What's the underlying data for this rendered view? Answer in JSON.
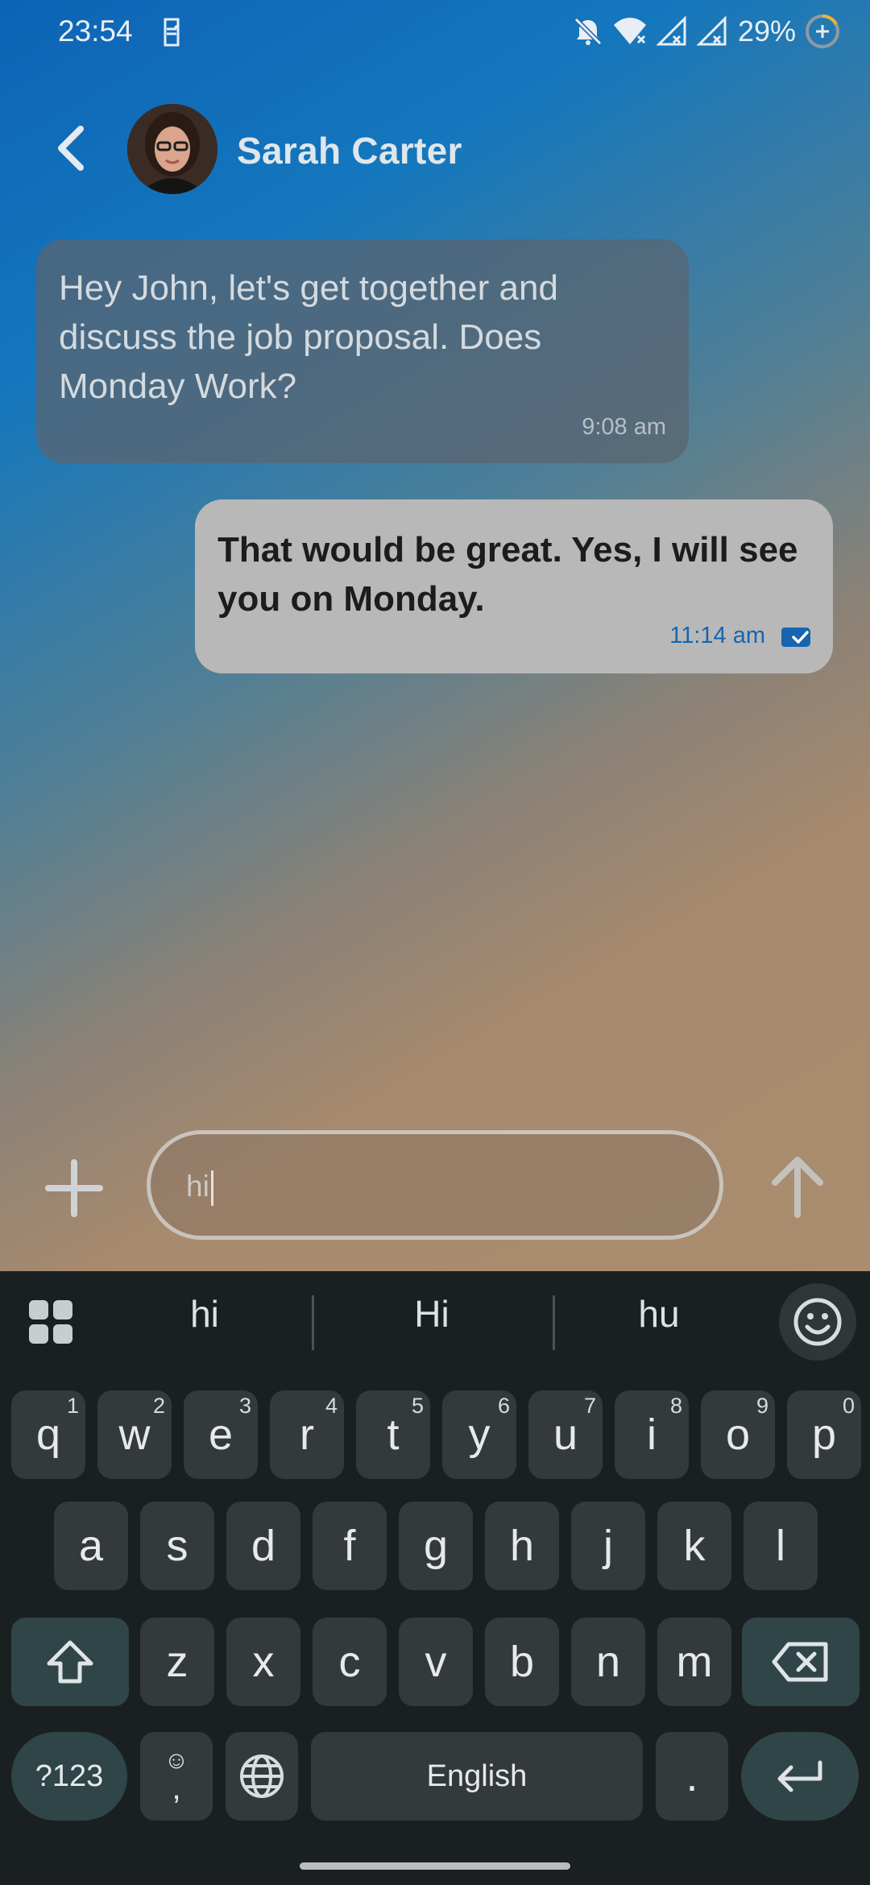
{
  "status_bar": {
    "time": "23:54",
    "battery": "29%"
  },
  "header": {
    "contact_name": "Sarah Carter"
  },
  "messages": [
    {
      "direction": "incoming",
      "text": "Hey John, let's get together and discuss the job proposal. Does Monday Work?",
      "time": "9:08 am"
    },
    {
      "direction": "outgoing",
      "text": "That would be great. Yes, I will see you on Monday.",
      "time": "11:14 am"
    }
  ],
  "composer": {
    "value": "hi"
  },
  "keyboard": {
    "suggestions": [
      "hi",
      "Hi",
      "hu"
    ],
    "row1": [
      {
        "k": "q",
        "h": "1"
      },
      {
        "k": "w",
        "h": "2"
      },
      {
        "k": "e",
        "h": "3"
      },
      {
        "k": "r",
        "h": "4"
      },
      {
        "k": "t",
        "h": "5"
      },
      {
        "k": "y",
        "h": "6"
      },
      {
        "k": "u",
        "h": "7"
      },
      {
        "k": "i",
        "h": "8"
      },
      {
        "k": "o",
        "h": "9"
      },
      {
        "k": "p",
        "h": "0"
      }
    ],
    "row2": [
      "a",
      "s",
      "d",
      "f",
      "g",
      "h",
      "j",
      "k",
      "l"
    ],
    "row3": [
      "z",
      "x",
      "c",
      "v",
      "b",
      "n",
      "m"
    ],
    "symbols_label": "?123",
    "comma_label": ",",
    "space_label": "English",
    "period_label": ".",
    "icons": {
      "shift": "shift-icon",
      "backspace": "backspace-icon",
      "enter": "enter-icon",
      "globe": "globe-icon",
      "emoji": "emoji-icon",
      "apps": "apps-grid-icon"
    }
  },
  "colors": {
    "accent": "#1565b0",
    "keyboard_bg": "#1a2022",
    "key_bg": "#343a3c"
  }
}
